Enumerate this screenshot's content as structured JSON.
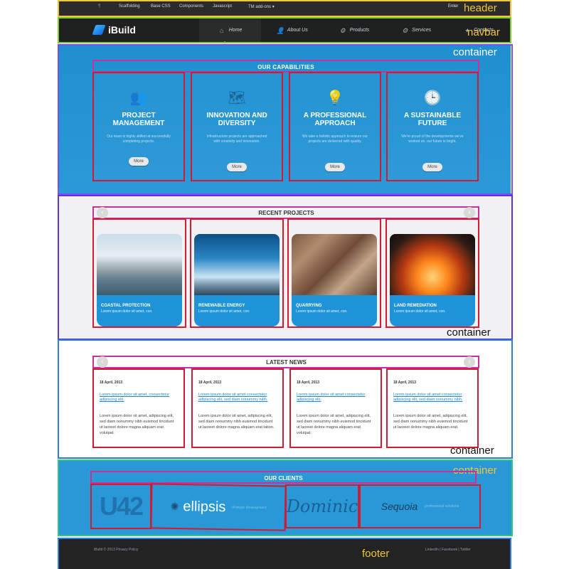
{
  "header": {
    "items": [
      "Scaffolding",
      "Base CSS",
      "Components",
      "Javascript",
      "TM add-ons"
    ],
    "dropdown_caret": "▾",
    "right_text": "Enter",
    "tag": "header"
  },
  "navbar": {
    "brand": "iBuild",
    "items": [
      {
        "label": "Home",
        "icon": "home-icon",
        "glyph": "⌂"
      },
      {
        "label": "About Us",
        "icon": "user-icon",
        "glyph": "👤"
      },
      {
        "label": "Products",
        "icon": "gear-icon",
        "glyph": "⚙"
      },
      {
        "label": "Services",
        "icon": "settings-icon",
        "glyph": "⚙"
      },
      {
        "label": "Contacts",
        "icon": "tools-icon",
        "glyph": "✦"
      }
    ],
    "tag": "navbar"
  },
  "capabilities": {
    "title": "OUR CAPABILITIES",
    "tag": "container",
    "cards": [
      {
        "icon": "team-icon",
        "glyph": "👥",
        "title": "PROJECT MANAGEMENT",
        "text": "Our team is highly skilled at successfully completing projects.",
        "button": "More"
      },
      {
        "icon": "map-icon",
        "glyph": "🗺",
        "title": "INNOVATION AND DIVERSITY",
        "text": "Infrastructure projects are approached with creativity and innovation.",
        "button": "More"
      },
      {
        "icon": "lightbulb-icon",
        "glyph": "💡",
        "title": "A PROFESSIONAL APPROACH",
        "text": "We take a holistic approach to ensure our projects are delivered with quality.",
        "button": "More"
      },
      {
        "icon": "clock-icon",
        "glyph": "🕒",
        "title": "A SUSTAINABLE FUTURE",
        "text": "We're proud of the developments we've worked on, our future is bright.",
        "button": "More"
      }
    ]
  },
  "projects": {
    "title": "RECENT PROJECTS",
    "tag": "container",
    "prev": "‹",
    "next": "›",
    "items": [
      {
        "title": "COASTAL PROTECTION",
        "text": "Lorem ipsum dolor sit amet, con."
      },
      {
        "title": "RENEWABLE ENERGY",
        "text": "Lorem ipsum dolor sit amet, con."
      },
      {
        "title": "QUARRYING",
        "text": "Lorem ipsum dolor sit amet, con."
      },
      {
        "title": "LAND REMEDIATION",
        "text": "Lorem ipsum dolor sit amet, con."
      }
    ]
  },
  "news": {
    "title": "LATEST NEWS",
    "tag": "container",
    "prev": "‹",
    "next": "›",
    "items": [
      {
        "date": "18 April, 2013",
        "link": "Lorem ipsum dolor sit amet, consectetur adipiscing elit.",
        "text": "Lorem ipsum dolor sit amet, adipiscing elit, sed diam nonummy nibh euismod tincidunt ut laoreet dolore magna aliquam erat volutpat."
      },
      {
        "date": "18 April, 2013",
        "link": "Lorem ipsum dolor sit amet consectetur adipiscing elit, sed diam nonummy nibh.",
        "text": "Lorem ipsum dolor sit amet, adipiscing elit, sed diam nonummy nibh euismod tincidunt ut laoreet dolore magna aliquam erat tation."
      },
      {
        "date": "18 April, 2013",
        "link": "Lorem ipsum dolor sit amet consectetur adipiscing elit.",
        "text": "Lorem ipsum dolor sit amet, adipiscing elit, sed diam nonummy nibh euismod tincidunt ut laoreet dolore magna aliquam erat volutpat."
      },
      {
        "date": "18 April, 2013",
        "link": "Lorem ipsum dolor sit amet consectetur adipiscing elit, sed diam nonummy nibh.",
        "text": "Lorem ipsum dolor sit amet, adipiscing elit, sed diam nonummy nibh euismod tincidunt ut laoreet dolore magna aliquam erat."
      }
    ]
  },
  "clients": {
    "title": "OUR CLIENTS",
    "tag": "container",
    "logos": [
      "U42",
      "ellipsis",
      "Dominic",
      "Sequoia"
    ],
    "logo_subtexts": [
      "",
      "strategic development",
      "",
      "professional solutions"
    ]
  },
  "footer": {
    "left": "iBuild © 2013 Privacy Policy",
    "right": "LinkedIn | Facebook | Twitter",
    "tag": "footer"
  },
  "colors": {
    "accent": "#1f8fd0",
    "card_outline": "#d01b35",
    "header_outline": "#f2c53d",
    "navbar_outline": "#7ccf2e"
  }
}
